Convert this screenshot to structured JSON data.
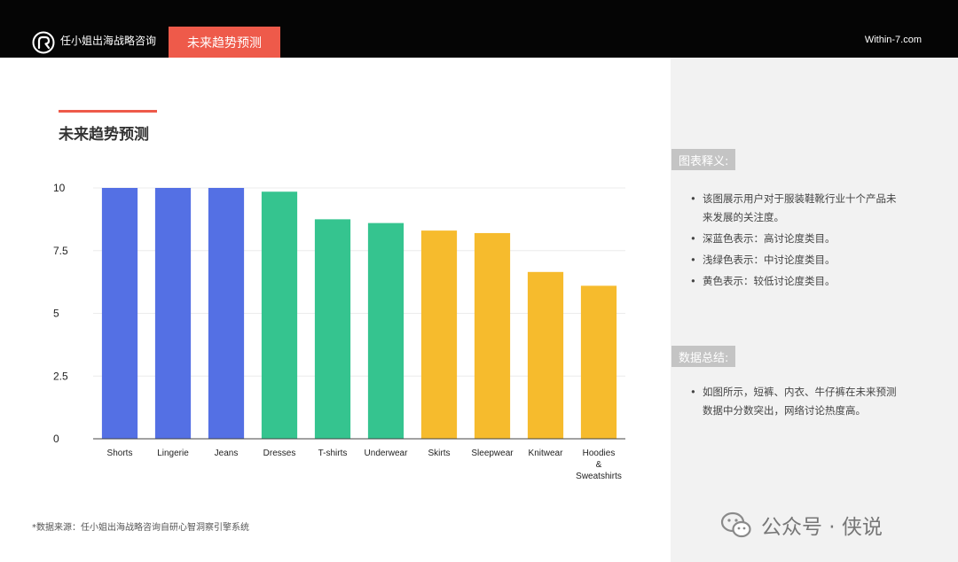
{
  "header": {
    "brand": "任小姐出海战略咨询",
    "active_tab": "未来趋势预测",
    "site": "Within-7.com"
  },
  "main": {
    "section_title": "未来趋势预测",
    "footnote": "*数据来源：任小姐出海战略咨询自研心智洞察引擎系统"
  },
  "sidebar": {
    "legend_tag": "图表释义:",
    "legend_items": [
      "该图展示用户对于服装鞋靴行业十个产品未来发展的关注度。",
      "深蓝色表示：高讨论度类目。",
      "浅绿色表示：中讨论度类目。",
      "黄色表示：较低讨论度类目。"
    ],
    "summary_tag": "数据总结:",
    "summary_items": [
      "如图所示，短裤、内衣、牛仔裤在未来预测数据中分数突出，网络讨论热度高。"
    ]
  },
  "watermark": {
    "text": "公众号 · 侠说",
    "icon": "wechat-icon"
  },
  "colors": {
    "accent": "#ee5a4a",
    "high": "#5470e4",
    "medium": "#35c48f",
    "low": "#f6bb2d"
  },
  "chart_data": {
    "type": "bar",
    "categories": [
      "Shorts",
      "Lingerie",
      "Jeans",
      "Dresses",
      "T-shirts",
      "Underwear",
      "Skirts",
      "Sleepwear",
      "Knitwear",
      "Hoodies & Sweatshirts"
    ],
    "values": [
      10,
      10,
      10,
      9.85,
      8.75,
      8.6,
      8.3,
      8.2,
      6.65,
      6.1
    ],
    "levels": [
      "high",
      "high",
      "high",
      "medium",
      "medium",
      "medium",
      "low",
      "low",
      "low",
      "low"
    ],
    "ylim": [
      0,
      10
    ],
    "yticks": [
      0,
      2.5,
      5,
      7.5,
      10
    ],
    "grid": true,
    "title": "",
    "xlabel": "",
    "ylabel": ""
  }
}
